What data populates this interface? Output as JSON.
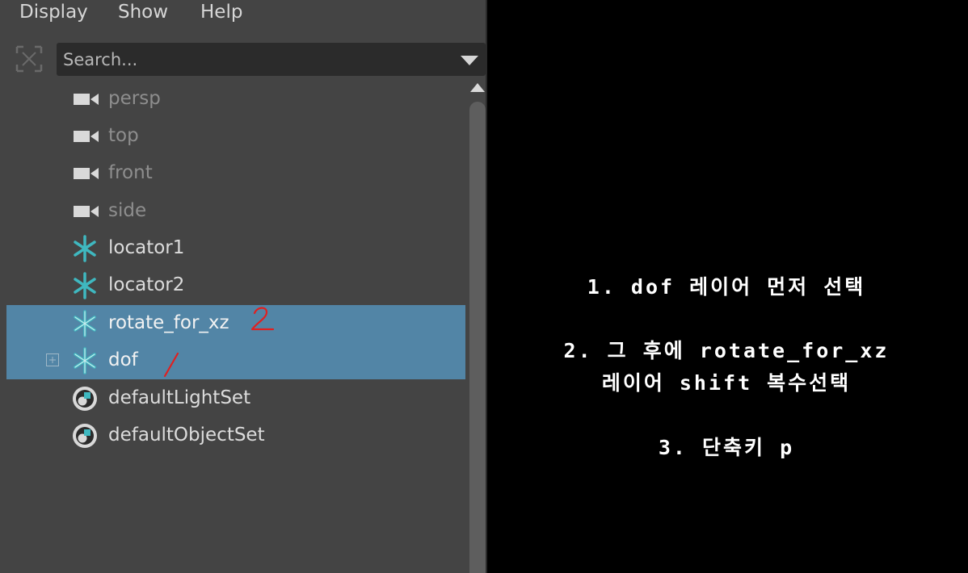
{
  "menubar": {
    "items": [
      "Display",
      "Show",
      "Help"
    ]
  },
  "search": {
    "placeholder": "Search..."
  },
  "outliner": {
    "items": [
      {
        "label": "persp",
        "icon": "camera-icon",
        "selected": false
      },
      {
        "label": "top",
        "icon": "camera-icon",
        "selected": false
      },
      {
        "label": "front",
        "icon": "camera-icon",
        "selected": false
      },
      {
        "label": "side",
        "icon": "camera-icon",
        "selected": false
      },
      {
        "label": "locator1",
        "icon": "locator-icon",
        "selected": false
      },
      {
        "label": "locator2",
        "icon": "locator-icon",
        "selected": false
      },
      {
        "label": "rotate_for_xz",
        "icon": "locator-icon",
        "selected": true
      },
      {
        "label": "dof",
        "icon": "locator-icon",
        "selected": true,
        "expandable": true
      },
      {
        "label": "defaultLightSet",
        "icon": "set-icon",
        "selected": false
      },
      {
        "label": "defaultObjectSet",
        "icon": "set-icon",
        "selected": false
      }
    ]
  },
  "colors": {
    "panel_bg": "#444444",
    "selection": "#5285a6",
    "locator": "#3fb8c0",
    "annotation": "#e02020"
  },
  "annotations": {
    "mark_rotate": "2",
    "mark_dof": "1"
  },
  "instructions": {
    "step1": "1. dof 레이어 먼저 선택",
    "step2_line1": "2. 그 후에 rotate_for_xz",
    "step2_line2": "레이어 shift 복수선택",
    "step3": "3. 단축키 p"
  }
}
